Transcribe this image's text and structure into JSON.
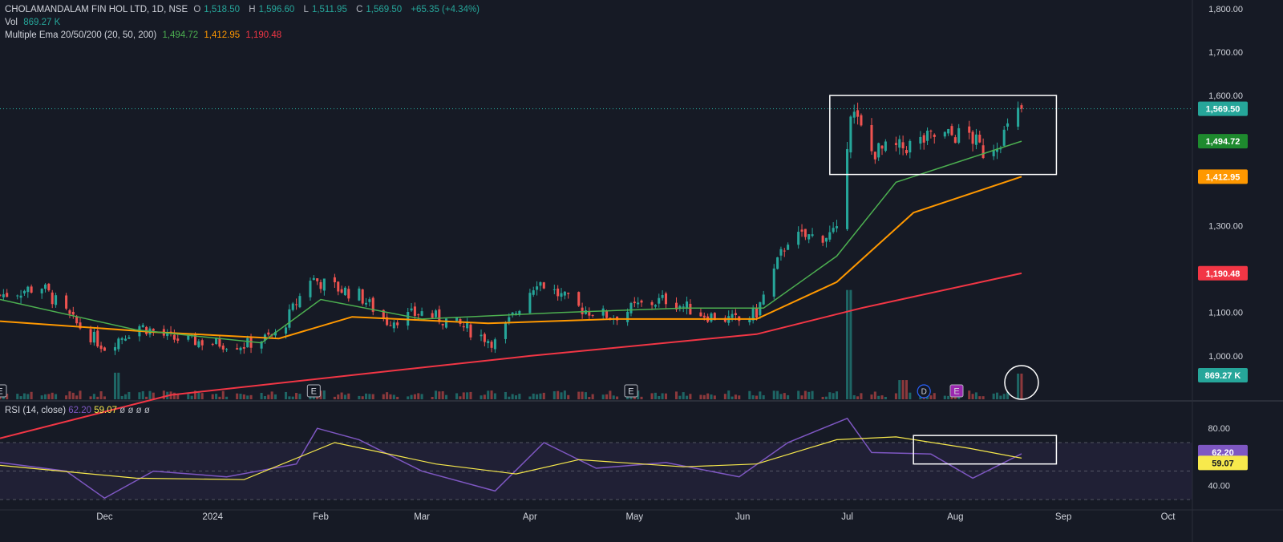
{
  "legend": {
    "symbol": "CHOLAMANDALAM FIN HOL LTD, 1D, NSE",
    "o_label": "O",
    "o_value": "1,518.50",
    "h_label": "H",
    "h_value": "1,596.60",
    "l_label": "L",
    "l_value": "1,511.95",
    "c_label": "C",
    "c_value": "1,569.50",
    "change": "+65.35 (+4.34%)",
    "vol_label": "Vol",
    "vol_value": "869.27 K",
    "ema_label": "Multiple Ema 20/50/200 (20, 50, 200)",
    "ema20_value": "1,494.72",
    "ema50_value": "1,412.95",
    "ema200_value": "1,190.48"
  },
  "rsi_legend": {
    "label": "RSI (14, close)",
    "rsi_value": "62.20",
    "ma_value": "59.07",
    "extra": "ø ø ø ø"
  },
  "colors": {
    "background": "#161a25",
    "up": "#26a69a",
    "down": "#ef5350",
    "ema20": "#4caf50",
    "ema50": "#ff9800",
    "ema200": "#f23645",
    "rsi": "#7e57c2",
    "rsi_ma": "#f7e94c",
    "annotation": "#ffffff"
  },
  "chart_data": {
    "type": "candlestick",
    "price_axis": {
      "ticks": [
        "1,800.00",
        "1,700.00",
        "1,600.00",
        "1,300.00",
        "1,100.00",
        "1,000.00"
      ],
      "ylim": [
        900,
        1820
      ]
    },
    "rsi_axis": {
      "ticks": [
        "80.00",
        "40.00"
      ],
      "ylim": [
        25,
        88
      ],
      "bands": [
        30,
        70
      ]
    },
    "x_labels": [
      "Dec",
      "2024",
      "Feb",
      "Mar",
      "Apr",
      "May",
      "Jun",
      "Jul",
      "Aug",
      "Sep",
      "Oct"
    ],
    "x_range": [
      "2023-11-01",
      "2024-10-08"
    ],
    "price_labels": [
      {
        "text": "1,569.50",
        "value": 1569.5,
        "color": "#26a69a"
      },
      {
        "text": "1,494.72",
        "value": 1494.72,
        "color": "#1e8a2e"
      },
      {
        "text": "1,412.95",
        "value": 1412.95,
        "color": "#ff9800"
      },
      {
        "text": "1,190.48",
        "value": 1190.48,
        "color": "#f23645"
      }
    ],
    "volume_label": {
      "text": "869.27 K"
    },
    "rsi_labels": [
      {
        "text": "62.20",
        "value": 62.2,
        "color": "#7e57c2"
      },
      {
        "text": "59.07",
        "value": 59.07,
        "color": "#f7e94c"
      }
    ],
    "earnings_markers": [
      {
        "date": "2023-11-01",
        "text": "E"
      },
      {
        "date": "2024-01-30",
        "text": "E"
      },
      {
        "date": "2024-04-30",
        "text": "E"
      },
      {
        "date": "2024-07-31",
        "text": "E"
      }
    ],
    "dividend_markers": [
      {
        "date": "2024-07-23",
        "text": "D"
      }
    ],
    "price_path": [
      [
        "2023-11-01",
        1140
      ],
      [
        "2023-11-13",
        1160
      ],
      [
        "2023-11-22",
        1080
      ],
      [
        "2023-12-01",
        1020
      ],
      [
        "2023-12-11",
        1070
      ],
      [
        "2023-12-20",
        1040
      ],
      [
        "2024-01-01",
        1030
      ],
      [
        "2024-01-10",
        1025
      ],
      [
        "2024-01-20",
        1050
      ],
      [
        "2024-01-29",
        1180
      ],
      [
        "2024-02-02",
        1165
      ],
      [
        "2024-02-12",
        1140
      ],
      [
        "2024-02-20",
        1080
      ],
      [
        "2024-03-01",
        1100
      ],
      [
        "2024-03-12",
        1070
      ],
      [
        "2024-03-22",
        1030
      ],
      [
        "2024-04-03",
        1175
      ],
      [
        "2024-04-15",
        1110
      ],
      [
        "2024-04-25",
        1090
      ],
      [
        "2024-05-02",
        1115
      ],
      [
        "2024-05-10",
        1130
      ],
      [
        "2024-05-21",
        1095
      ],
      [
        "2024-05-31",
        1080
      ],
      [
        "2024-06-05",
        1100
      ],
      [
        "2024-06-14",
        1270
      ],
      [
        "2024-06-28",
        1280
      ],
      [
        "2024-07-02",
        1570
      ],
      [
        "2024-07-08",
        1470
      ],
      [
        "2024-07-17",
        1480
      ],
      [
        "2024-07-26",
        1505
      ],
      [
        "2024-08-05",
        1510
      ],
      [
        "2024-08-09",
        1470
      ],
      [
        "2024-08-14",
        1500
      ],
      [
        "2024-08-20",
        1569.5
      ]
    ],
    "ema20": [
      [
        "2023-11-01",
        1130
      ],
      [
        "2023-12-10",
        1060
      ],
      [
        "2024-01-15",
        1030
      ],
      [
        "2024-02-01",
        1130
      ],
      [
        "2024-03-01",
        1085
      ],
      [
        "2024-04-10",
        1100
      ],
      [
        "2024-05-15",
        1110
      ],
      [
        "2024-06-07",
        1110
      ],
      [
        "2024-06-28",
        1230
      ],
      [
        "2024-07-15",
        1400
      ],
      [
        "2024-08-20",
        1494.72
      ]
    ],
    "ema50": [
      [
        "2023-11-01",
        1080
      ],
      [
        "2023-12-15",
        1055
      ],
      [
        "2024-01-20",
        1040
      ],
      [
        "2024-02-10",
        1090
      ],
      [
        "2024-03-20",
        1075
      ],
      [
        "2024-04-25",
        1085
      ],
      [
        "2024-06-05",
        1085
      ],
      [
        "2024-06-28",
        1170
      ],
      [
        "2024-07-20",
        1330
      ],
      [
        "2024-08-20",
        1412.95
      ]
    ],
    "ema200": [
      [
        "2023-11-01",
        810
      ],
      [
        "2023-12-20",
        910
      ],
      [
        "2024-02-15",
        960
      ],
      [
        "2024-04-01",
        1000
      ],
      [
        "2024-06-05",
        1050
      ],
      [
        "2024-07-05",
        1110
      ],
      [
        "2024-08-20",
        1190.48
      ]
    ],
    "volume_spikes_k": [
      [
        "2023-12-04",
        900
      ],
      [
        "2024-01-30",
        420
      ],
      [
        "2024-07-01",
        3700
      ],
      [
        "2024-07-17",
        650
      ],
      [
        "2024-08-20",
        869.27
      ]
    ],
    "rsi": [
      [
        "2023-11-01",
        56
      ],
      [
        "2023-11-20",
        50
      ],
      [
        "2023-12-01",
        31
      ],
      [
        "2023-12-15",
        50
      ],
      [
        "2024-01-05",
        46
      ],
      [
        "2024-01-25",
        55
      ],
      [
        "2024-01-31",
        80
      ],
      [
        "2024-02-12",
        72
      ],
      [
        "2024-03-01",
        50
      ],
      [
        "2024-03-22",
        36
      ],
      [
        "2024-04-05",
        70
      ],
      [
        "2024-04-20",
        52
      ],
      [
        "2024-05-10",
        56
      ],
      [
        "2024-05-31",
        46
      ],
      [
        "2024-06-14",
        70
      ],
      [
        "2024-07-01",
        87
      ],
      [
        "2024-07-08",
        63
      ],
      [
        "2024-07-25",
        62
      ],
      [
        "2024-08-06",
        45
      ],
      [
        "2024-08-20",
        62.2
      ]
    ],
    "rsi_ma": [
      [
        "2023-11-01",
        54
      ],
      [
        "2023-12-10",
        45
      ],
      [
        "2024-01-10",
        44
      ],
      [
        "2024-02-05",
        70
      ],
      [
        "2024-03-05",
        55
      ],
      [
        "2024-03-28",
        48
      ],
      [
        "2024-04-15",
        58
      ],
      [
        "2024-05-15",
        53
      ],
      [
        "2024-06-05",
        55
      ],
      [
        "2024-06-28",
        72
      ],
      [
        "2024-07-15",
        74
      ],
      [
        "2024-08-05",
        66
      ],
      [
        "2024-08-20",
        59.07
      ]
    ],
    "annotations": [
      {
        "shape": "rect",
        "pane": "price",
        "date_start": "2024-06-26",
        "date_end": "2024-08-30",
        "y_top": 1600,
        "y_bottom": 1418
      },
      {
        "shape": "rect",
        "pane": "rsi",
        "date_start": "2024-07-20",
        "date_end": "2024-08-30",
        "y_top": 75,
        "y_bottom": 55
      },
      {
        "shape": "circle",
        "pane": "volume",
        "date": "2024-08-20"
      }
    ]
  }
}
